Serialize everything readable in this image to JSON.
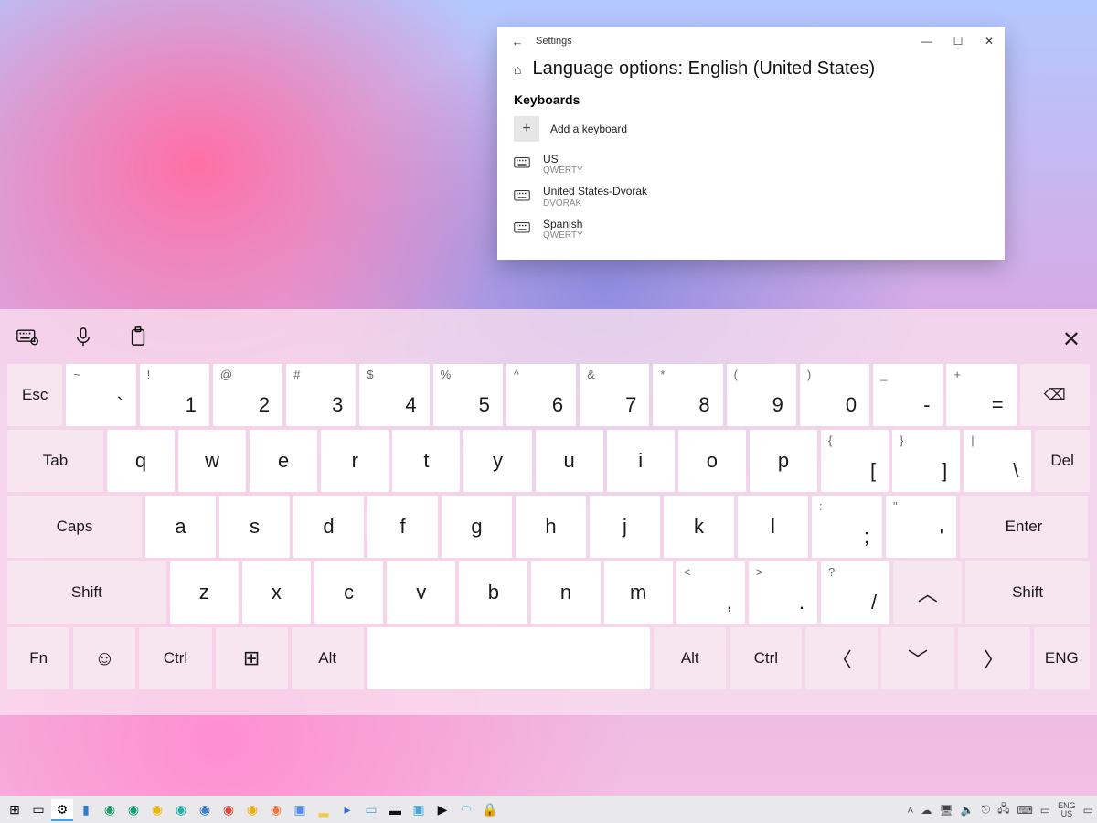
{
  "settings": {
    "app_name": "Settings",
    "page_title": "Language options: English (United States)",
    "section_heading": "Keyboards",
    "add_label": "Add a keyboard",
    "installed": [
      {
        "name": "US",
        "layout": "QWERTY"
      },
      {
        "name": "United States-Dvorak",
        "layout": "DVORAK"
      },
      {
        "name": "Spanish",
        "layout": "QWERTY"
      }
    ]
  },
  "keyboard": {
    "row1": [
      {
        "shift": "~",
        "main": "`"
      },
      {
        "shift": "!",
        "main": "1"
      },
      {
        "shift": "@",
        "main": "2"
      },
      {
        "shift": "#",
        "main": "3"
      },
      {
        "shift": "$",
        "main": "4"
      },
      {
        "shift": "%",
        "main": "5"
      },
      {
        "shift": "^",
        "main": "6"
      },
      {
        "shift": "&",
        "main": "7"
      },
      {
        "shift": "*",
        "main": "8"
      },
      {
        "shift": "(",
        "main": "9"
      },
      {
        "shift": ")",
        "main": "0"
      },
      {
        "shift": "_",
        "main": "-"
      },
      {
        "shift": "+",
        "main": "="
      }
    ],
    "row2_letters": [
      "q",
      "w",
      "e",
      "r",
      "t",
      "y",
      "u",
      "i",
      "o",
      "p"
    ],
    "row2_punct": [
      {
        "shift": "{",
        "main": "["
      },
      {
        "shift": "}",
        "main": "]"
      },
      {
        "shift": "|",
        "main": "\\"
      }
    ],
    "row3_letters": [
      "a",
      "s",
      "d",
      "f",
      "g",
      "h",
      "j",
      "k",
      "l"
    ],
    "row3_punct": [
      {
        "shift": ":",
        "main": ";"
      },
      {
        "shift": "\"",
        "main": "'"
      }
    ],
    "row4_letters": [
      "z",
      "x",
      "c",
      "v",
      "b",
      "n",
      "m"
    ],
    "row4_punct": [
      {
        "shift": "<",
        "main": ","
      },
      {
        "shift": ">",
        "main": "."
      },
      {
        "shift": "?",
        "main": "/"
      }
    ],
    "mods": {
      "esc": "Esc",
      "tab": "Tab",
      "del": "Del",
      "caps": "Caps",
      "enter": "Enter",
      "shift": "Shift",
      "fn": "Fn",
      "ctrl": "Ctrl",
      "alt": "Alt",
      "lang": "ENG"
    }
  },
  "taskbar": {
    "lang1": "ENG",
    "lang2": "US"
  }
}
